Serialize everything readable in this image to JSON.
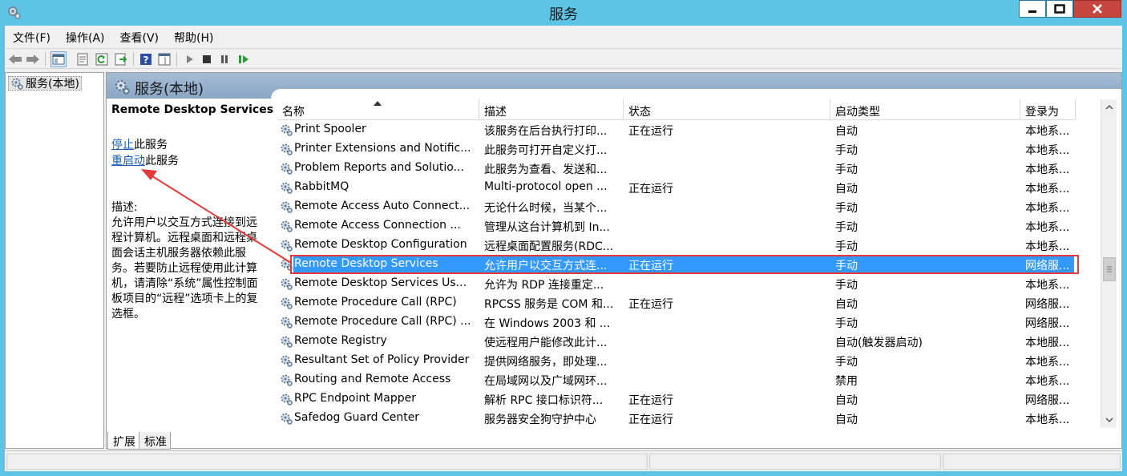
{
  "window": {
    "title": "服务"
  },
  "menu": [
    "文件(F)",
    "操作(A)",
    "查看(V)",
    "帮助(H)"
  ],
  "tree": {
    "item": "服务(本地)"
  },
  "pane": {
    "header": "服务(本地)"
  },
  "details": {
    "service_name": "Remote Desktop Services",
    "stop_link": "停止",
    "stop_suffix": "此服务",
    "restart_link": "重启动",
    "restart_suffix": "此服务",
    "desc_label": "描述:",
    "desc_lines": [
      "允许用户以交互方式连接到远",
      "程计算机。远程桌面和远程桌",
      "面会话主机服务器依赖此服",
      "务。若要防止远程使用此计算",
      "机，请清除“系统”属性控制面",
      "板项目的“远程”选项卡上的复",
      "选框。"
    ]
  },
  "columns": [
    "名称",
    "描述",
    "状态",
    "启动类型",
    "登录为"
  ],
  "rows": [
    {
      "name": "Print Spooler",
      "desc": "该服务在后台执行打印...",
      "status": "正在运行",
      "startup": "自动",
      "logon": "本地系..."
    },
    {
      "name": "Printer Extensions and Notific...",
      "desc": "此服务可打开自定义打...",
      "status": "",
      "startup": "手动",
      "logon": "本地系..."
    },
    {
      "name": "Problem Reports and Solutio...",
      "desc": "此服务为查看、发送和...",
      "status": "",
      "startup": "手动",
      "logon": "本地系..."
    },
    {
      "name": "RabbitMQ",
      "desc": "Multi-protocol open ...",
      "status": "正在运行",
      "startup": "自动",
      "logon": "本地系..."
    },
    {
      "name": "Remote Access Auto Connect...",
      "desc": "无论什么时候，当某个...",
      "status": "",
      "startup": "手动",
      "logon": "本地系..."
    },
    {
      "name": "Remote Access Connection ...",
      "desc": "管理从这台计算机到 In...",
      "status": "",
      "startup": "手动",
      "logon": "本地系..."
    },
    {
      "name": "Remote Desktop Configuration",
      "desc": "远程桌面配置服务(RDC...",
      "status": "",
      "startup": "手动",
      "logon": "本地系..."
    },
    {
      "name": "Remote Desktop Services",
      "desc": "允许用户以交互方式连...",
      "status": "正在运行",
      "startup": "手动",
      "logon": "网络服..."
    },
    {
      "name": "Remote Desktop Services Us...",
      "desc": "允许为 RDP 连接重定...",
      "status": "",
      "startup": "手动",
      "logon": "本地系..."
    },
    {
      "name": "Remote Procedure Call (RPC)",
      "desc": "RPCSS 服务是 COM 和...",
      "status": "正在运行",
      "startup": "自动",
      "logon": "网络服..."
    },
    {
      "name": "Remote Procedure Call (RPC) ...",
      "desc": "在 Windows 2003 和 ...",
      "status": "",
      "startup": "手动",
      "logon": "网络服..."
    },
    {
      "name": "Remote Registry",
      "desc": "使远程用户能修改此计...",
      "status": "",
      "startup": "自动(触发器启动)",
      "logon": "本地服..."
    },
    {
      "name": "Resultant Set of Policy Provider",
      "desc": "提供网络服务，即处理...",
      "status": "",
      "startup": "手动",
      "logon": "本地系..."
    },
    {
      "name": "Routing and Remote Access",
      "desc": "在局域网以及广域网环...",
      "status": "",
      "startup": "禁用",
      "logon": "本地系..."
    },
    {
      "name": "RPC Endpoint Mapper",
      "desc": "解析 RPC 接口标识符...",
      "status": "正在运行",
      "startup": "自动",
      "logon": "网络服..."
    },
    {
      "name": "Safedog Guard Center",
      "desc": "服务器安全狗守护中心",
      "status": "正在运行",
      "startup": "自动",
      "logon": "本地系..."
    }
  ],
  "selected_index": 7,
  "tabs": [
    "扩展",
    "标准"
  ],
  "colors": {
    "titlebar": "#5ec4e6",
    "selection": "#3399ff",
    "annotation": "#e23a3a",
    "link": "#1a5fb4"
  }
}
